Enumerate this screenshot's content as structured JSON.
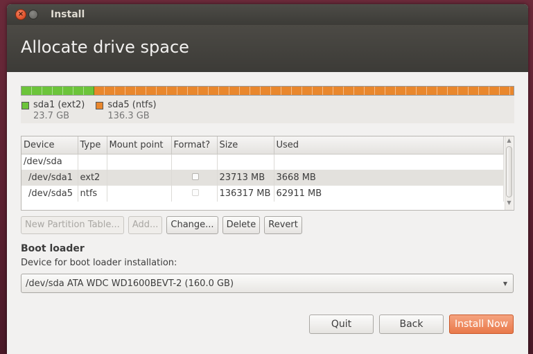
{
  "window": {
    "title": "Install"
  },
  "header": {
    "title": "Allocate drive space"
  },
  "disk_bar": {
    "segments": [
      {
        "name": "sda1 (ext2)",
        "size": "23.7 GB",
        "color": "#6cc43a",
        "fraction": 0.148
      },
      {
        "name": "sda5 (ntfs)",
        "size": "136.3 GB",
        "color": "#e9872d",
        "fraction": 0.852
      }
    ]
  },
  "partition_table": {
    "columns": [
      "Device",
      "Type",
      "Mount point",
      "Format?",
      "Size",
      "Used"
    ],
    "rows": [
      {
        "device": "/dev/sda",
        "type": "",
        "mount": "",
        "format": null,
        "size": "",
        "used": ""
      },
      {
        "device": "/dev/sda1",
        "type": "ext2",
        "mount": "",
        "format": false,
        "size": "23713 MB",
        "used": "3668 MB",
        "selected": true
      },
      {
        "device": "/dev/sda5",
        "type": "ntfs",
        "mount": "",
        "format": false,
        "size": "136317 MB",
        "used": "62911 MB"
      }
    ]
  },
  "partition_buttons": {
    "new_table": "New Partition Table...",
    "add": "Add...",
    "change": "Change...",
    "delete": "Delete",
    "revert": "Revert"
  },
  "boot_loader": {
    "title": "Boot loader",
    "label": "Device for boot loader installation:",
    "selected": "/dev/sda ATA WDC WD1600BEVT-2 (160.0 GB)"
  },
  "footer": {
    "quit": "Quit",
    "back": "Back",
    "install": "Install Now"
  },
  "colors": {
    "accent": "#e9794a",
    "header_bg": "#3c3b37"
  }
}
